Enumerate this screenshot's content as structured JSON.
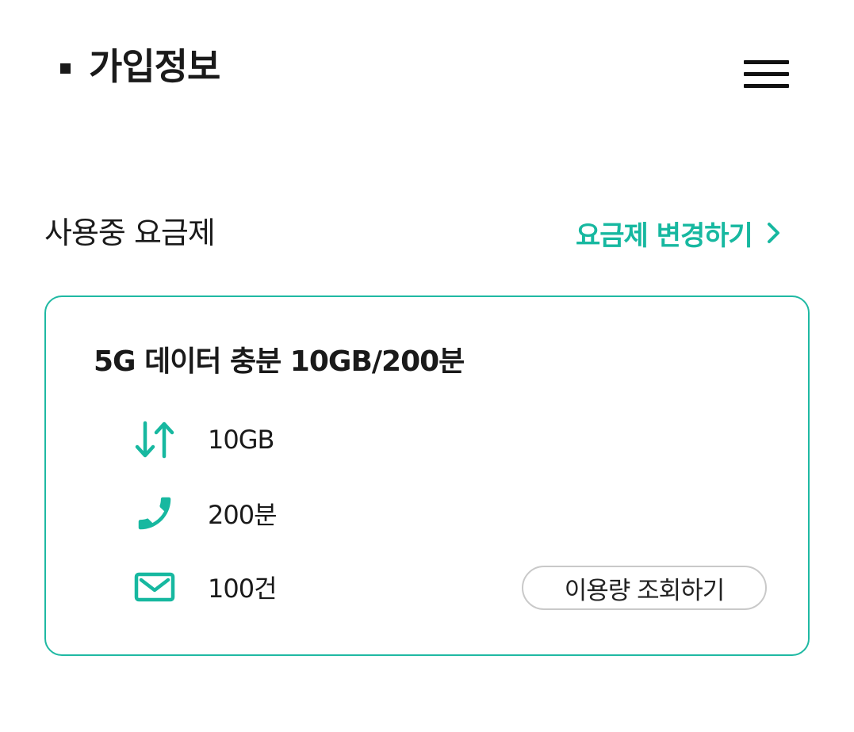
{
  "header": {
    "title": "가입정보",
    "menu_icon": "hamburger-menu-icon"
  },
  "section": {
    "title": "사용중 요금제",
    "change_link_label": "요금제 변경하기",
    "change_link_icon": "chevron-right-icon"
  },
  "plan": {
    "name": "5G 데이터 충분 10GB/200분",
    "details": [
      {
        "icon": "data-transfer-arrows-icon",
        "value": "10GB"
      },
      {
        "icon": "phone-icon",
        "value": "200분"
      },
      {
        "icon": "mail-icon",
        "value": "100건"
      }
    ],
    "usage_button_label": "이용량 조회하기"
  },
  "colors": {
    "accent": "#17b8a0",
    "card_border": "#1fb9a3",
    "text": "#1a1a1a",
    "button_border": "#c9c9c9"
  }
}
